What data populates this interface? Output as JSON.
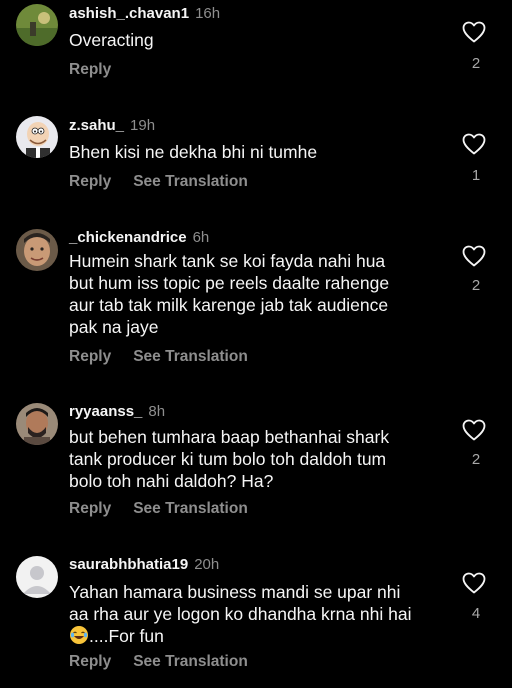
{
  "comments": [
    {
      "username": "ashish_.chavan1",
      "time": "16h",
      "lines": [
        "Overacting"
      ],
      "reply": "Reply",
      "translate": "",
      "likes": "2"
    },
    {
      "username": "z.sahu_",
      "time": "19h",
      "lines": [
        "Bhen kisi ne dekha bhi ni tumhe"
      ],
      "reply": "Reply",
      "translate": "See Translation",
      "likes": "1"
    },
    {
      "username": "_chickenandrice",
      "time": "6h",
      "lines": [
        "Humein shark tank se koi fayda nahi hua",
        "but hum iss topic pe reels daalte rahenge",
        "aur tab tak milk karenge jab tak audience",
        "pak na jaye"
      ],
      "reply": "Reply",
      "translate": "See Translation",
      "likes": "2"
    },
    {
      "username": "ryyaanss_",
      "time": "8h",
      "lines": [
        "but behen tumhara baap bethanhai shark",
        "tank producer ki tum bolo toh daldoh tum",
        "bolo toh nahi daldoh? Ha?"
      ],
      "reply": "Reply",
      "translate": "See Translation",
      "likes": "2"
    },
    {
      "username": "saurabhbhatia19",
      "time": "20h",
      "lines": [
        "Yahan hamara business mandi se upar nhi",
        "aa rha aur ye logon ko dhandha krna nhi hai"
      ],
      "last_line_text": "....For fun",
      "emoji": "face-with-tears-of-joy",
      "reply": "Reply",
      "translate": "See Translation",
      "likes": "4"
    }
  ],
  "colors": {
    "background": "#000000",
    "text": "#f5f5f5",
    "secondary": "#8e8e8e"
  }
}
